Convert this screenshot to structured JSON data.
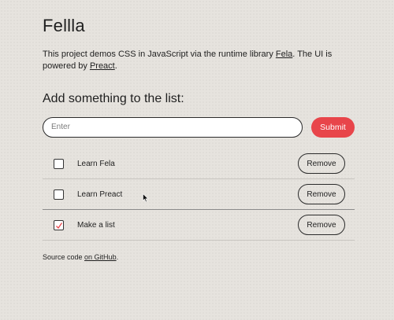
{
  "title": "Fellla",
  "intro": {
    "before_fela": "This project demos CSS in JavaScript via the runtime library ",
    "fela_link": "Fela",
    "middle": ". The UI is powered by ",
    "preact_link": "Preact",
    "after": "."
  },
  "add_heading": "Add something to the list:",
  "input": {
    "placeholder": "Enter",
    "value": ""
  },
  "submit_label": "Submit",
  "items": [
    {
      "label": "Learn Fela",
      "checked": false,
      "remove_label": "Remove"
    },
    {
      "label": "Learn Preact",
      "checked": false,
      "remove_label": "Remove"
    },
    {
      "label": "Make a list",
      "checked": true,
      "remove_label": "Remove"
    }
  ],
  "footer": {
    "before": "Source code ",
    "link": "on GitHub",
    "after": "."
  },
  "colors": {
    "accent": "#e8454a",
    "background": "#e6e3de"
  }
}
